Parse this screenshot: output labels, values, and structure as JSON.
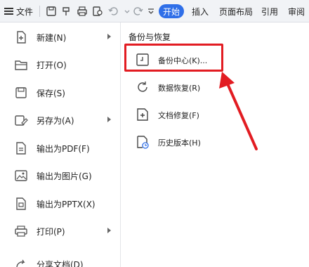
{
  "toolbar": {
    "file_label": "文件",
    "tabs": [
      "开始",
      "插入",
      "页面布局",
      "引用",
      "审阅"
    ]
  },
  "left_menu": [
    {
      "label": "新建(N)",
      "icon": "new-doc-icon",
      "submenu": true
    },
    {
      "label": "打开(O)",
      "icon": "folder-open-icon",
      "submenu": false
    },
    {
      "label": "保存(S)",
      "icon": "save-icon",
      "submenu": false
    },
    {
      "label": "另存为(A)",
      "icon": "save-as-icon",
      "submenu": true
    },
    {
      "label": "输出为PDF(F)",
      "icon": "export-pdf-icon",
      "submenu": false
    },
    {
      "label": "输出为图片(G)",
      "icon": "export-image-icon",
      "submenu": false
    },
    {
      "label": "输出为PPTX(X)",
      "icon": "export-pptx-icon",
      "submenu": false
    },
    {
      "label": "打印(P)",
      "icon": "print-icon",
      "submenu": true
    },
    {
      "label": "分享文档(D)",
      "icon": "share-icon",
      "submenu": false
    }
  ],
  "right_pane": {
    "title": "备份与恢复",
    "items": [
      {
        "label": "备份中心(K)...",
        "icon": "backup-center-icon"
      },
      {
        "label": "数据恢复(R)",
        "icon": "data-recovery-icon"
      },
      {
        "label": "文档修复(F)",
        "icon": "doc-repair-icon"
      },
      {
        "label": "历史版本(H)",
        "icon": "history-version-icon"
      }
    ]
  },
  "annotation": {
    "color": "#e21c22"
  }
}
